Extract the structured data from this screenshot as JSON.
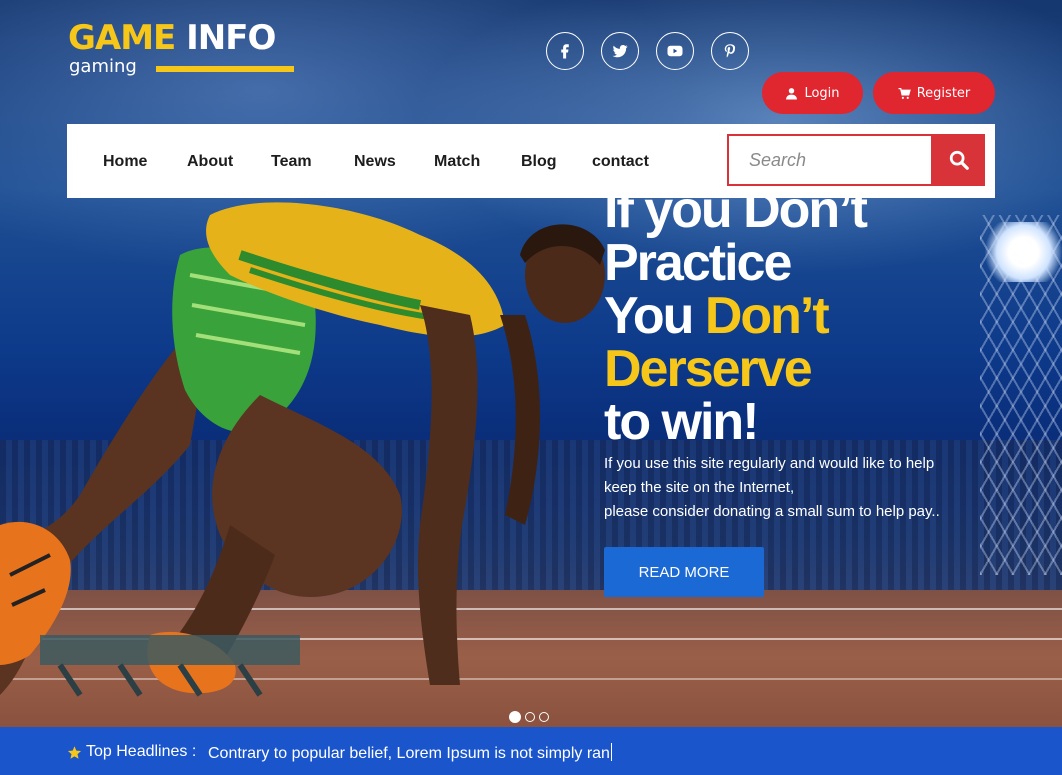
{
  "brand": {
    "title_part1": "GAME",
    "title_part2": "INFO",
    "subtitle": "gaming"
  },
  "social": [
    {
      "icon": "facebook-icon"
    },
    {
      "icon": "twitter-icon"
    },
    {
      "icon": "youtube-icon"
    },
    {
      "icon": "pinterest-icon"
    }
  ],
  "auth": {
    "login_label": "Login",
    "register_label": "Register"
  },
  "nav": {
    "items": [
      "Home",
      "About",
      "Team",
      "News",
      "Match",
      "Blog",
      "contact"
    ]
  },
  "search": {
    "placeholder": "Search",
    "value": ""
  },
  "hero": {
    "line1": "If you Don’t",
    "line2": "Practice",
    "line3a": "You ",
    "line3b": "Don’t",
    "line4": "Derserve",
    "line5": "to win!",
    "desc_line1": "If you use this site regularly and would like to help",
    "desc_line2": "keep the site on the Internet,",
    "desc_line3": "please consider donating a small sum to help pay..",
    "cta_label": "READ MORE",
    "slides_total": 3,
    "slide_active": 1
  },
  "ticker": {
    "label": "Top Headlines :",
    "text": "Contrary to popular belief, Lorem Ipsum is not simply ran"
  },
  "colors": {
    "accent_yellow": "#f6c619",
    "accent_red": "#e0262f",
    "cta_blue": "#1a69d4",
    "ticker_blue": "#1a55cc"
  }
}
